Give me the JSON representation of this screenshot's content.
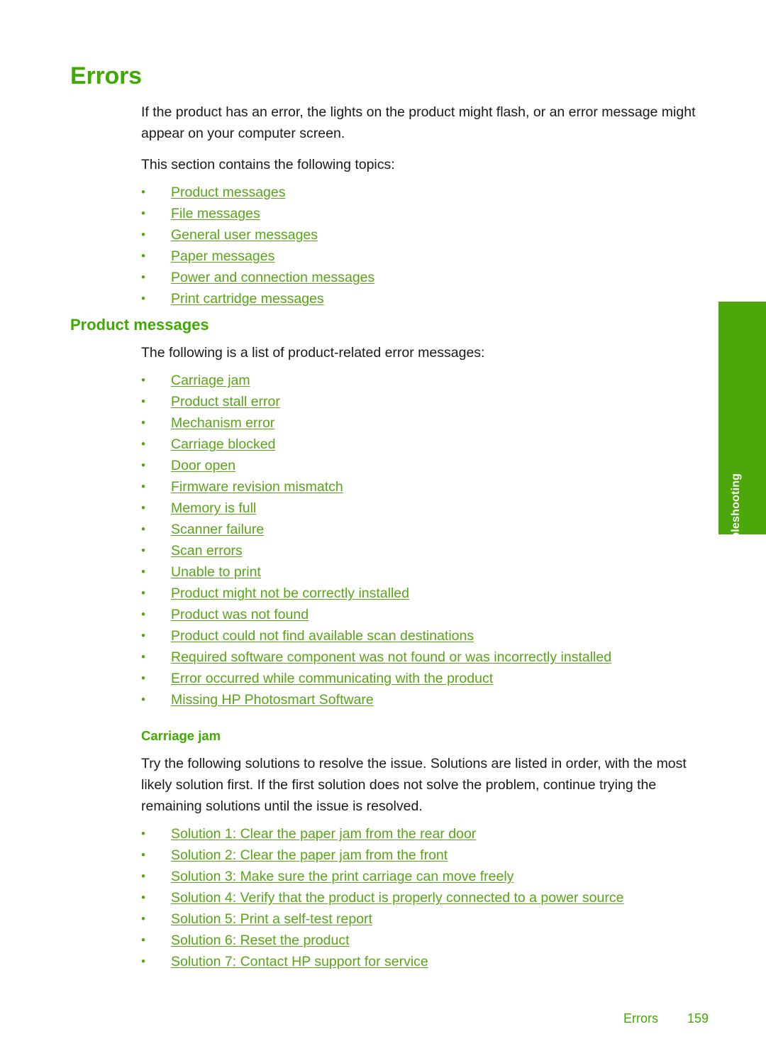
{
  "page": {
    "title": "Errors",
    "intro_paragraph": "If the product has an error, the lights on the product might flash, or an error message might appear on your computer screen.",
    "topics_lead": "This section contains the following topics:",
    "topic_links": [
      "Product messages",
      "File messages",
      "General user messages",
      "Paper messages",
      "Power and connection messages",
      "Print cartridge messages"
    ]
  },
  "product_messages": {
    "heading": "Product messages",
    "lead": "The following is a list of product-related error messages:",
    "links": [
      "Carriage jam",
      "Product stall error",
      "Mechanism error",
      "Carriage blocked",
      "Door open",
      "Firmware revision mismatch",
      "Memory is full",
      "Scanner failure",
      "Scan errors",
      "Unable to print",
      "Product might not be correctly installed",
      "Product was not found",
      "Product could not find available scan destinations",
      "Required software component was not found or was incorrectly installed",
      "Error occurred while communicating with the product",
      "Missing HP Photosmart Software"
    ]
  },
  "carriage_jam": {
    "heading": "Carriage jam",
    "paragraph": "Try the following solutions to resolve the issue. Solutions are listed in order, with the most likely solution first. If the first solution does not solve the problem, continue trying the remaining solutions until the issue is resolved.",
    "solutions": [
      "Solution 1: Clear the paper jam from the rear door",
      "Solution 2: Clear the paper jam from the front",
      "Solution 3: Make sure the print carriage can move freely",
      "Solution 4: Verify that the product is properly connected to a power source",
      "Solution 5: Print a self-test report",
      "Solution 6: Reset the product",
      "Solution 7: Contact HP support for service"
    ]
  },
  "side_tab": {
    "label": "Troubleshooting"
  },
  "footer": {
    "section": "Errors",
    "page_number": "159"
  },
  "colors": {
    "title_green": "#3faa00",
    "link_green": "#5aa417",
    "tab_green": "#4ca80a",
    "body_black": "#1a1a1a"
  }
}
